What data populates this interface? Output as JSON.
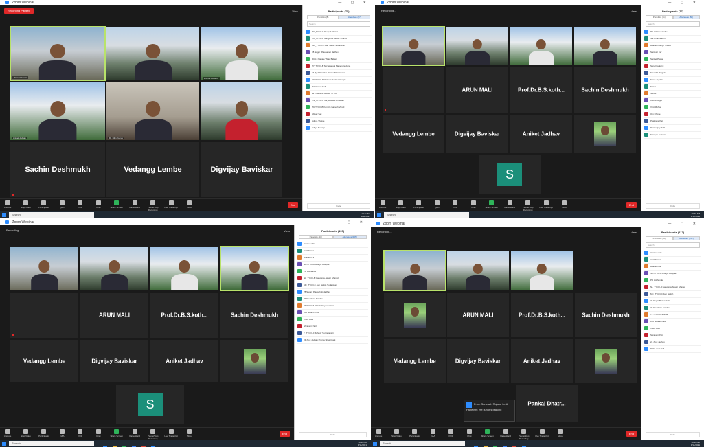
{
  "window": {
    "title": "Zoom Webinar",
    "view_label": "View",
    "buttons": "—  ▢  ✕"
  },
  "recording": {
    "q1": "Recording Paused",
    "q2": "Recording...",
    "q3": "Recording...",
    "q4": "Recording..."
  },
  "q1": {
    "labels": [
      "Prasad Kumar",
      "",
      "Prof.Dr.Kulkarni",
      "Aniket Jadhav",
      "Dr. Nitin Kumar",
      ""
    ],
    "names": [
      "Sachin Deshmukh",
      "Vedangg Lembe",
      "Digvijay Baviskar"
    ],
    "participants_title": "Participants (75)",
    "tabs": [
      "Panelists (8)",
      "Attendees (67)"
    ],
    "search_placeholder": "Search",
    "list": [
      "SG_TYCO-B Deepali Kharat",
      "NK_TYCO-B Gangurde Akash Sharad",
      "MC_TYCO-C Jain Satish Sudarshan",
      "78 Sagar Bhausaheb Jadhav",
      "PC-LT-Navale Vikas Baban",
      "TY_TYCO-B Suryavanshi Mahendra Anna",
      "24 Jyoti Sinalkar Prerna Shashikant",
      "CS-TYCO-A Khairnar Sanket Dongar",
      "D30 Laxmi Sali",
      "22 Pratiksha Jadhav TYCO",
      "SN_TYCO-A Suryavanshi Bhushan",
      "NK-TYCO-B Kamble Ganesh Vinod",
      "Abhay Sali",
      "Aditya Thakre",
      "Aditya Bairagi"
    ],
    "footer": "Invite"
  },
  "q2": {
    "names": [
      "ARUN MALI",
      "Prof.Dr.B.S.koth...",
      "Sachin Deshmukh",
      "Vedangg Lembe",
      "Digvijay Baviskar",
      "Aniket Jadhav"
    ],
    "s_avatar": "S",
    "participants_title": "Participants (77)",
    "tabs": [
      "Panelists (11)",
      "Attendees (66)"
    ],
    "list": [
      "RS Ashish Kamble",
      "Sai Kiran Nikam",
      "Bhavesh Singh Thakur",
      "Santosh Kar",
      "Sanket Pawar",
      "Sonal Kulkarni",
      "Saurabh Pingale",
      "Swati Jagdale",
      "Shruti",
      "Sonali",
      "Komal Bagul",
      "Vinit Mehta",
      "Om Dhone",
      "Pratiksha Patil",
      "Dhananjay Patil",
      "Shreyas Kulkarni"
    ],
    "footer": "Invite"
  },
  "q3": {
    "names": [
      "ARUN MALI",
      "Prof.Dr.B.S.koth...",
      "Sachin Deshmukh",
      "Vedangg Lembe",
      "Digvijay Baviskar",
      "Aniket Jadhav"
    ],
    "s_avatar": "S",
    "participants_title": "Participants (115)",
    "tabs": [
      "Panelists (10)",
      "Attendees (105)"
    ],
    "list": [
      "Aman Lohar",
      "Aarti Sirsat",
      "Bhavesh Sr",
      "SK-TYCO-B Bidaye Deepak",
      "PD Lokhande",
      "NL_TYCO-B Gangurde Akash Sharad",
      "MC_TYCO-C Jain Satish Sudarshan",
      "78 Sagar Bhausaheb Jadhav",
      "73 Shubham Kamble",
      "74 TYCO-A Shinde Dnyaneshwar",
      "106 Gaurav Patil",
      "Vivek Patil",
      "Shravani Patil",
      "T_TYCO-B Mahavir Suryavanshi",
      "24 Jyoti Jadhav Prerna Shashikant"
    ],
    "footer": "Invite"
  },
  "q4": {
    "names": [
      "ARUN MALI",
      "Prof.Dr.B.S.koth...",
      "Sachin Deshmukh",
      "Vedangg Lembe",
      "Digvijay Baviskar",
      "Aniket Jadhav",
      "Pankaj Dhatr..."
    ],
    "toast_text": "From Somnath Rajane to All Panelists: He is not speaking",
    "participants_title": "Participants (117)",
    "tabs": [
      "Panelists (10)",
      "Attendees (107)"
    ],
    "list": [
      "Aman Lohar",
      "Aarti Sirsat",
      "Bhavesh Sr",
      "SK-TYCO-B Bidaye Deepak",
      "PD Lokhande",
      "NL_TYCO-B Gangurde Akash Sharad",
      "MC_TYCO-C Jain Satish",
      "78 Sagar Bhausaheb",
      "73 Shubham Kamble",
      "74 TYCO-A Shinde",
      "106 Gaurav Patil",
      "Vivek Patil",
      "Shravani Patil",
      "24 Jyoti Jadhav",
      "D30 Laxmi Sali"
    ],
    "footer": "Invite"
  },
  "controls": [
    "Unmute",
    "Stop Video",
    "Participants",
    "Q&A",
    "Polls",
    "Chat",
    "Share Screen",
    "Raise Hand",
    "Pause/Stop Recording",
    "Live Transcript",
    "More"
  ],
  "end_label": "End",
  "taskbar": {
    "search": "Search",
    "time": "10:41 AM",
    "date": "1/11/2021"
  },
  "list_colors": [
    "#2d8cff",
    "#1b8f7a",
    "#e07b2e",
    "#6a4fb3",
    "#2fb45a",
    "#c4212e",
    "#3b5998"
  ]
}
